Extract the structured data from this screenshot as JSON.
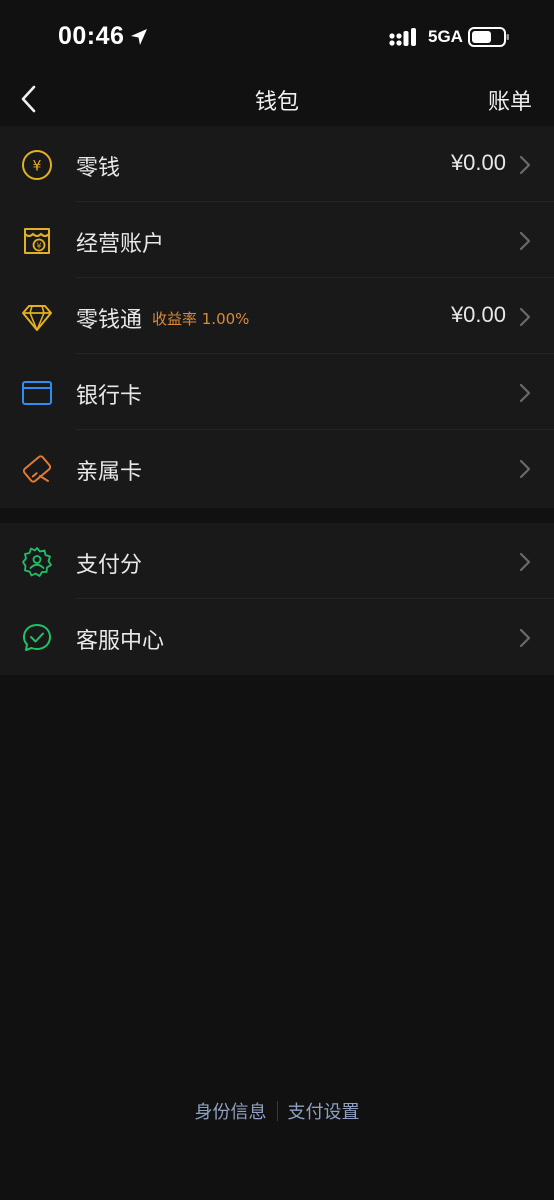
{
  "status_bar": {
    "time": "00:46",
    "network": "5GA"
  },
  "nav": {
    "title": "钱包",
    "right_action": "账单"
  },
  "groups": [
    {
      "items": [
        {
          "label": "零钱",
          "value": "¥0.00",
          "icon": "coin-yuan-icon"
        },
        {
          "label": "经营账户",
          "icon": "business-account-icon"
        },
        {
          "label": "零钱通",
          "sublabel": "收益率 1.00%",
          "value": "¥0.00",
          "icon": "diamond-icon"
        },
        {
          "label": "银行卡",
          "icon": "bank-card-icon"
        },
        {
          "label": "亲属卡",
          "icon": "family-card-icon"
        }
      ]
    },
    {
      "items": [
        {
          "label": "支付分",
          "icon": "pay-score-icon"
        },
        {
          "label": "客服中心",
          "icon": "customer-service-icon"
        }
      ]
    }
  ],
  "footer": {
    "links": [
      "身份信息",
      "支付设置"
    ]
  },
  "colors": {
    "background": "#111111",
    "list_background": "#191919",
    "accent_orange": "#d98a3a",
    "icon_yellow": "#e2b022",
    "icon_blue": "#2f8cf0",
    "icon_green": "#1ec168",
    "footer_link": "#8fa0c0"
  }
}
